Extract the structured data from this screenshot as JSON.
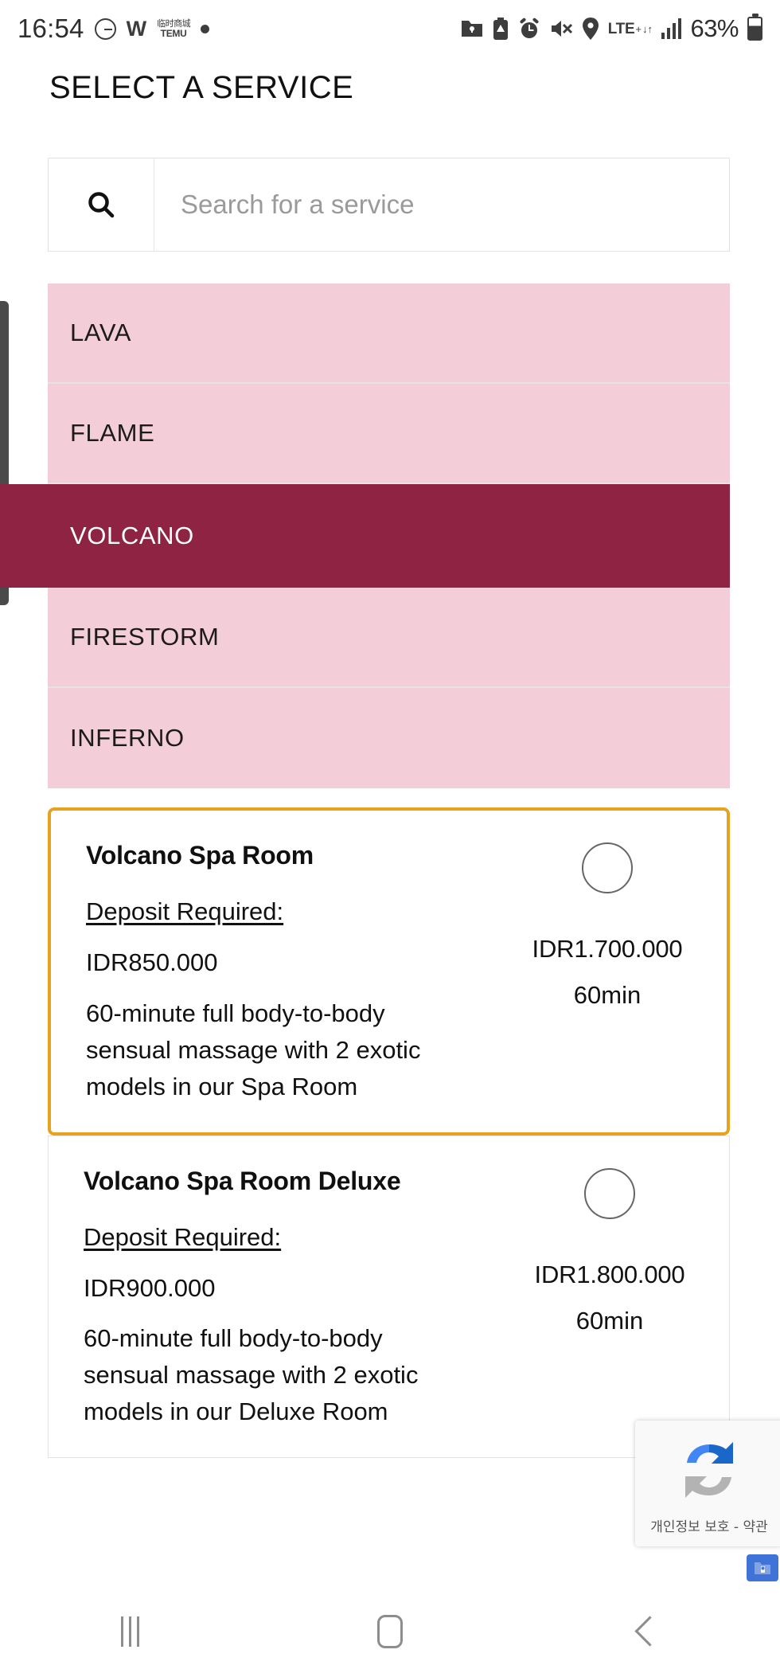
{
  "statusbar": {
    "time": "16:54",
    "battery_percent": "63%",
    "network_label": "LTE",
    "network_sup": "+",
    "left_icons": [
      "google-icon",
      "w-app-icon",
      "temu-icon",
      "dot-icon"
    ],
    "temu_top": "临时商城",
    "temu_bottom": "TEMU",
    "right_icons": [
      "folder-lock-icon",
      "battery-saver-icon",
      "alarm-icon",
      "mute-icon",
      "location-icon",
      "lte-icon",
      "signal-icon",
      "battery-icon"
    ]
  },
  "header": {
    "title": "SELECT A SERVICE"
  },
  "search": {
    "placeholder": "Search for a service",
    "value": "",
    "icon": "search-icon"
  },
  "categories": [
    {
      "label": "LAVA",
      "selected": false
    },
    {
      "label": "FLAME",
      "selected": false
    },
    {
      "label": "VOLCANO",
      "selected": true
    },
    {
      "label": "FIRESTORM",
      "selected": false
    },
    {
      "label": "INFERNO",
      "selected": false
    }
  ],
  "services": [
    {
      "title": "Volcano Spa Room",
      "deposit_label": "Deposit Required:",
      "deposit_amount": "IDR850.000",
      "description": "60-minute full body-to-body sensual massage with 2 exotic models in our Spa Room",
      "price": "IDR1.700.000",
      "duration": "60min",
      "highlighted": true,
      "selected": false
    },
    {
      "title": "Volcano Spa Room Deluxe",
      "deposit_label": "Deposit Required:",
      "deposit_amount": "IDR900.000",
      "description": "60-minute full body-to-body sensual massage with 2 exotic models in our Deluxe Room",
      "price": "IDR1.800.000",
      "duration": "60min",
      "highlighted": false,
      "selected": false
    }
  ],
  "recaptcha": {
    "text": "개인정보 보호 - 약관",
    "icon": "recaptcha-icon"
  },
  "navbar": {
    "recents_label": "recents-icon",
    "home_label": "home-icon",
    "back_label": "back-icon"
  },
  "colors": {
    "category_bg": "#F3CDD7",
    "category_selected_bg": "#8E2344",
    "card_highlight_border": "#E5A31F",
    "text": "#111111"
  }
}
